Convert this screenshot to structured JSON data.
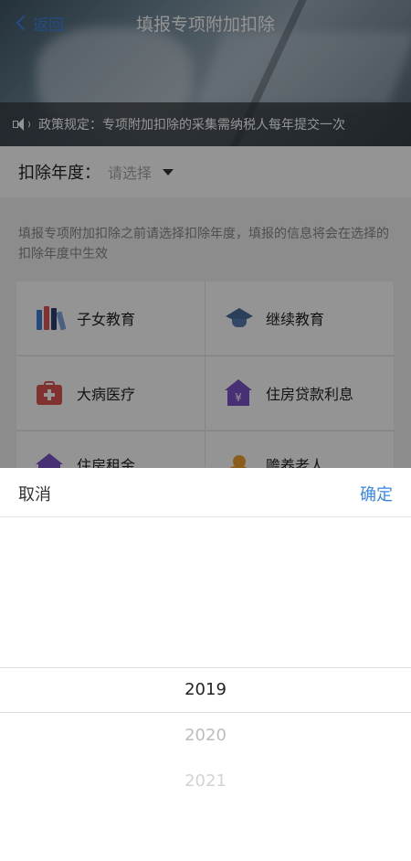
{
  "header": {
    "back_label": "返回",
    "title": "填报专项附加扣除"
  },
  "notice": {
    "icon": "speaker-icon",
    "text": "政策规定：专项附加扣除的采集需纳税人每年提交一次"
  },
  "year_selector": {
    "label": "扣除年度：",
    "placeholder": "请选择"
  },
  "hint": "填报专项附加扣除之前请选择扣除年度，填报的信息将会在选择的扣除年度中生效",
  "categories": [
    {
      "label": "子女教育",
      "icon": "books-icon"
    },
    {
      "label": "继续教育",
      "icon": "graduation-cap-icon"
    },
    {
      "label": "大病医疗",
      "icon": "medical-kit-icon"
    },
    {
      "label": "住房贷款利息",
      "icon": "house-yen-icon"
    },
    {
      "label": "住房租金",
      "icon": "house-icon"
    },
    {
      "label": "赡养老人",
      "icon": "elderly-icon"
    }
  ],
  "picker": {
    "cancel_label": "取消",
    "confirm_label": "确定",
    "options": [
      "2019",
      "2020",
      "2021"
    ],
    "selected": "2019"
  },
  "colors": {
    "accent": "#3a86e6",
    "overlay": "rgba(0,0,0,0.42)"
  }
}
